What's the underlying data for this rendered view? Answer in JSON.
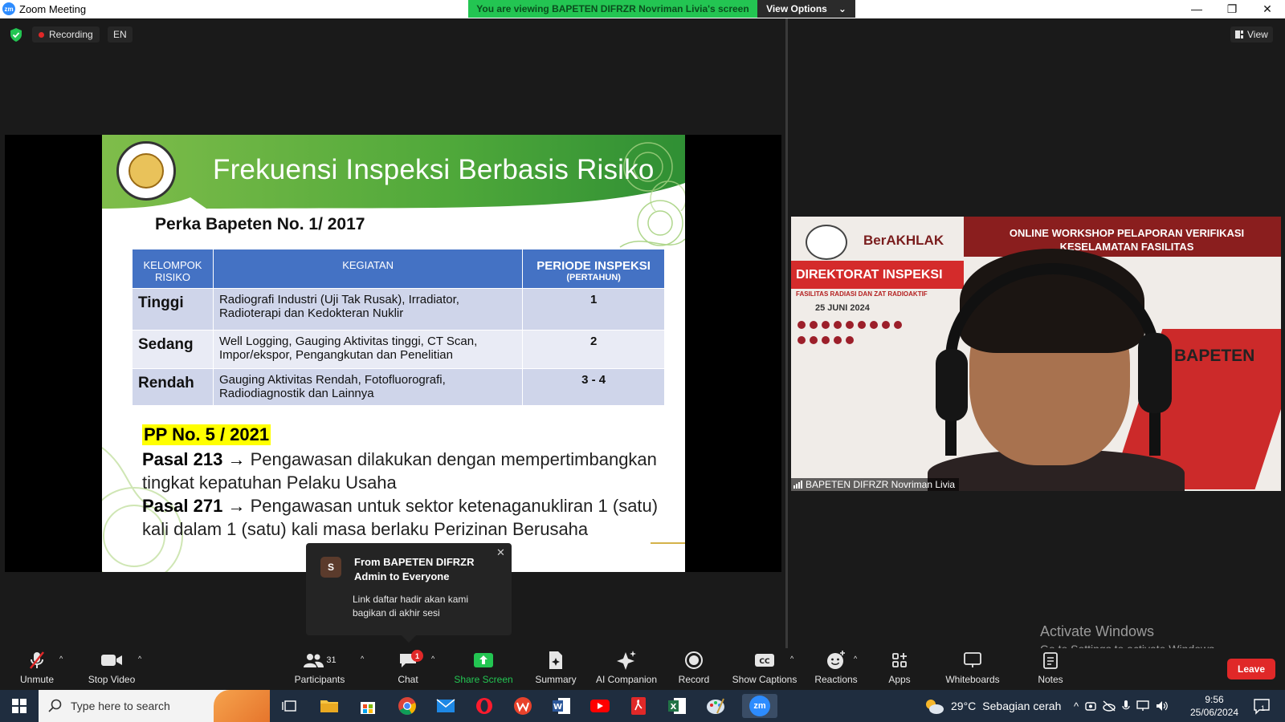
{
  "window": {
    "title": "Zoom Meeting",
    "viewing_banner": "You are viewing BAPETEN DIFRZR Novriman Livia's screen",
    "view_options": "View Options",
    "minimize_glyph": "—",
    "maximize_glyph": "❐",
    "close_glyph": "✕"
  },
  "status": {
    "recording": "Recording",
    "language": "EN",
    "view": "View"
  },
  "slide": {
    "title": "Frekuensi Inspeksi Berbasis Risiko",
    "subtitle": "Perka Bapeten No. 1/ 2017",
    "table": {
      "headers": {
        "kelompok": "KELOMPOK RISIKO",
        "kegiatan": "KEGIATAN",
        "periode": "PERIODE INSPEKSI",
        "periode_sub": "(PERTAHUN)"
      },
      "rows": [
        {
          "level": "Tinggi",
          "kegiatan": "Radiografi Industri (Uji Tak Rusak), Irradiator, Radioterapi dan Kedokteran Nuklir",
          "periode": "1"
        },
        {
          "level": "Sedang",
          "kegiatan": "Well Logging, Gauging Aktivitas tinggi, CT Scan, Impor/ekspor, Pengangkutan dan Penelitian",
          "periode": "2"
        },
        {
          "level": "Rendah",
          "kegiatan": "Gauging Aktivitas Rendah, Fotofluorografi, Radiodiagnostik dan Lainnya",
          "periode": "3 - 4"
        }
      ]
    },
    "pp_title": "PP No. 5 / 2021",
    "pasal_213_label": "Pasal 213",
    "pasal_213_text": "Pengawasan dilakukan dengan mempertimbangkan tingkat kepatuhan Pelaku Usaha",
    "pasal_271_label": "Pasal 271",
    "pasal_271_text": "Pengawasan untuk sektor ketenaganukliran 1 (satu) kali dalam 1 (satu) kali masa berlaku Perizinan Berusaha",
    "arrow": "→"
  },
  "chat_toast": {
    "avatar_letter": "S",
    "from": "From BAPETEN DIFRZR Admin to Everyone",
    "message": "Link daftar hadir akan kami bagikan di akhir sesi"
  },
  "video": {
    "participant_name": "BAPETEN DIFRZR Novriman Livia",
    "bg_berakhlak": "BerAKHLAK",
    "bg_workshop": "ONLINE WORKSHOP PELAPORAN VERIFIKASI KESELAMATAN FASILITAS",
    "bg_direktorat": "DIREKTORAT INSPEKSI",
    "bg_fasilitas": "FASILITAS RADIASI DAN ZAT RADIOAKTIF",
    "bg_date": "25 JUNI 2024",
    "bg_bapeten": "BAPETEN"
  },
  "watermark": {
    "line1": "Activate Windows",
    "line2": "Go to Settings to activate Windows."
  },
  "toolbar": {
    "unmute": "Unmute",
    "stop_video": "Stop Video",
    "participants": "Participants",
    "participants_count": "31",
    "chat": "Chat",
    "chat_badge": "1",
    "share_screen": "Share Screen",
    "summary": "Summary",
    "ai_companion": "AI Companion",
    "record": "Record",
    "show_captions": "Show Captions",
    "reactions": "Reactions",
    "apps": "Apps",
    "whiteboards": "Whiteboards",
    "notes": "Notes",
    "leave": "Leave"
  },
  "taskbar": {
    "search_placeholder": "Type here to search",
    "weather_temp": "29°C",
    "weather_desc": "Sebagian cerah",
    "time": "9:56",
    "date": "25/06/2024",
    "notification_count": "1"
  },
  "colors": {
    "zoom_green": "#23c552",
    "table_header": "#4472c4",
    "leave_red": "#e02828",
    "slide_green": "#5fae3c"
  }
}
